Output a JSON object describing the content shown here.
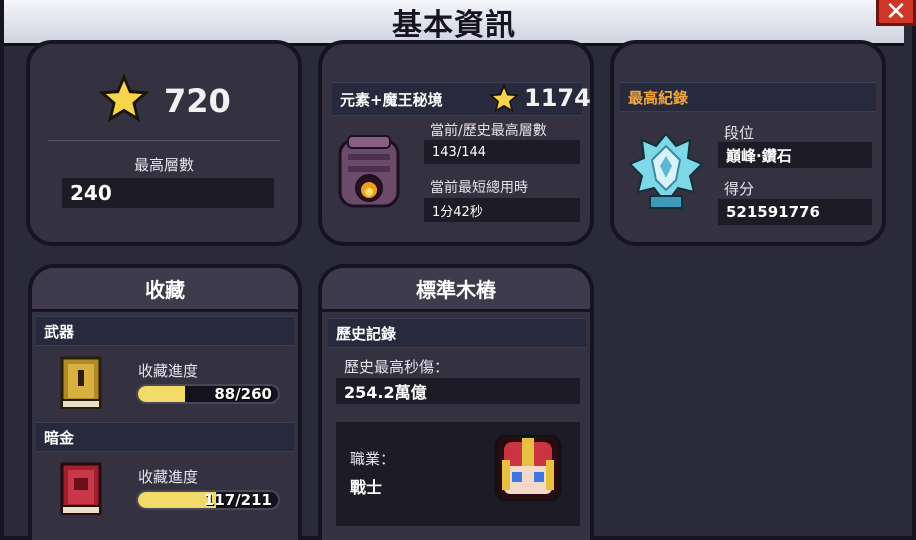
{
  "window": {
    "title": "基本資訊",
    "close": "✕"
  },
  "panel_total": {
    "stars": "720",
    "highest_floor_label": "最高層數",
    "highest_floor_value": "240"
  },
  "panel_dungeon": {
    "name": "元素+魔王秘境",
    "stars": "1174",
    "floor_label": "當前/歷史最高層數",
    "floor_value": "143/144",
    "time_label": "當前最短總用時",
    "time_value": "1分42秒"
  },
  "panel_record": {
    "header": "最高紀錄",
    "rank_label": "段位",
    "rank_value": "巔峰·鑽石",
    "score_label": "得分",
    "score_value": "521591776"
  },
  "panel_collection": {
    "title": "收藏",
    "weapons": {
      "header": "武器",
      "progress_label": "收藏進度",
      "progress_text": "88/260",
      "current": 88,
      "total": 260
    },
    "dark_gold": {
      "header": "暗金",
      "progress_label": "收藏進度",
      "progress_text": "117/211",
      "current": 117,
      "total": 211
    }
  },
  "panel_dummy": {
    "title": "標準木樁",
    "section": "歷史記錄",
    "dps_label": "歷史最高秒傷：",
    "dps_value": "254.2萬億",
    "class_label": "職業：",
    "class_value": "戰士"
  },
  "colors": {
    "star": "#f7d54a",
    "progress": "#f2da68",
    "record_header": "#f0a63a"
  }
}
